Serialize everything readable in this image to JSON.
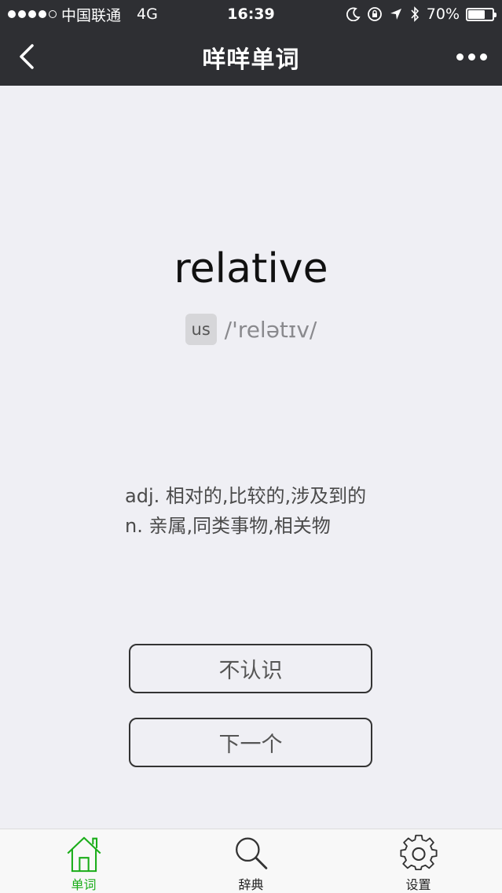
{
  "status_bar": {
    "carrier": "中国联通",
    "network": "4G",
    "time": "16:39",
    "battery": "70%",
    "battery_level": 0.7
  },
  "nav": {
    "title": "咩咩单词",
    "back_icon": "chevron-left-icon",
    "more_icon": "more-dots-icon"
  },
  "word": {
    "text": "relative",
    "pron_badge": "us",
    "phonetic": "/'relətɪv/"
  },
  "meanings": [
    "adj. 相对的,比较的,涉及到的",
    "n. 亲属,同类事物,相关物"
  ],
  "buttons": {
    "unknown_label": "不认识",
    "next_label": "下一个"
  },
  "tabs": [
    {
      "label": "单词",
      "icon": "home-icon",
      "active": true
    },
    {
      "label": "辞典",
      "icon": "search-icon",
      "active": false
    },
    {
      "label": "设置",
      "icon": "gear-icon",
      "active": false
    }
  ],
  "colors": {
    "bar": "#2e2f33",
    "background": "#efeff4",
    "active_tab": "#1aad19"
  }
}
